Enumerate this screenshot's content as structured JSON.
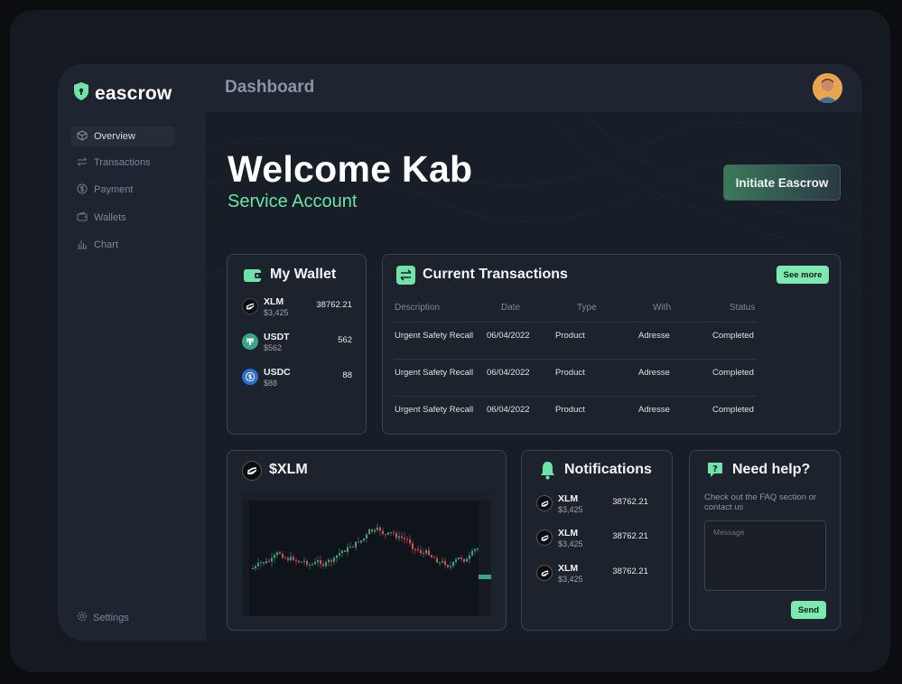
{
  "app": {
    "name": "eascrow",
    "page_title": "Dashboard"
  },
  "sidebar": {
    "items": [
      {
        "label": "Overview",
        "icon": "cube-icon",
        "active": true
      },
      {
        "label": "Transactions",
        "icon": "arrows-icon",
        "active": false
      },
      {
        "label": "Payment",
        "icon": "dollar-icon",
        "active": false
      },
      {
        "label": "Wallets",
        "icon": "wallet-icon",
        "active": false
      },
      {
        "label": "Chart",
        "icon": "bar-chart-icon",
        "active": false
      }
    ],
    "settings_label": "Settings"
  },
  "welcome": {
    "heading": "Welcome Kab",
    "subtitle": "Service Account",
    "cta_label": "Initiate Eascrow"
  },
  "wallet": {
    "title": "My Wallet",
    "assets": [
      {
        "symbol": "XLM",
        "usd": "$3,425",
        "amount": "38762.21",
        "icon": "stellar-icon"
      },
      {
        "symbol": "USDT",
        "usd": "$562",
        "amount": "562",
        "icon": "tether-icon"
      },
      {
        "symbol": "USDC",
        "usd": "$88",
        "amount": "88",
        "icon": "usdc-icon"
      }
    ]
  },
  "transactions": {
    "title": "Current Transactions",
    "see_more": "See more",
    "columns": [
      "Description",
      "Date",
      "Type",
      "With",
      "Status"
    ],
    "rows": [
      {
        "description": "Urgent Safety Recall",
        "date": "06/04/2022",
        "type": "Product",
        "with": "Adresse",
        "status": "Completed"
      },
      {
        "description": "Urgent Safety Recall",
        "date": "06/04/2022",
        "type": "Product",
        "with": "Adresse",
        "status": "Completed"
      },
      {
        "description": "Urgent Safety Recall",
        "date": "06/04/2022",
        "type": "Product",
        "with": "Adresse",
        "status": "Completed"
      }
    ]
  },
  "xlm_chart": {
    "title": "$XLM"
  },
  "notifications": {
    "title": "Notifications",
    "items": [
      {
        "symbol": "XLM",
        "usd": "$3,425",
        "amount": "38762.21"
      },
      {
        "symbol": "XLM",
        "usd": "$3,425",
        "amount": "38762.21"
      },
      {
        "symbol": "XLM",
        "usd": "$3,425",
        "amount": "38762.21"
      }
    ]
  },
  "help": {
    "title": "Need help?",
    "text": "Check out the FAQ section or contact us",
    "placeholder": "Message",
    "send_label": "Send"
  },
  "colors": {
    "accent": "#6fe3a8",
    "button": "#7de8b0",
    "panel": "#1d232d",
    "background": "#181e27"
  }
}
